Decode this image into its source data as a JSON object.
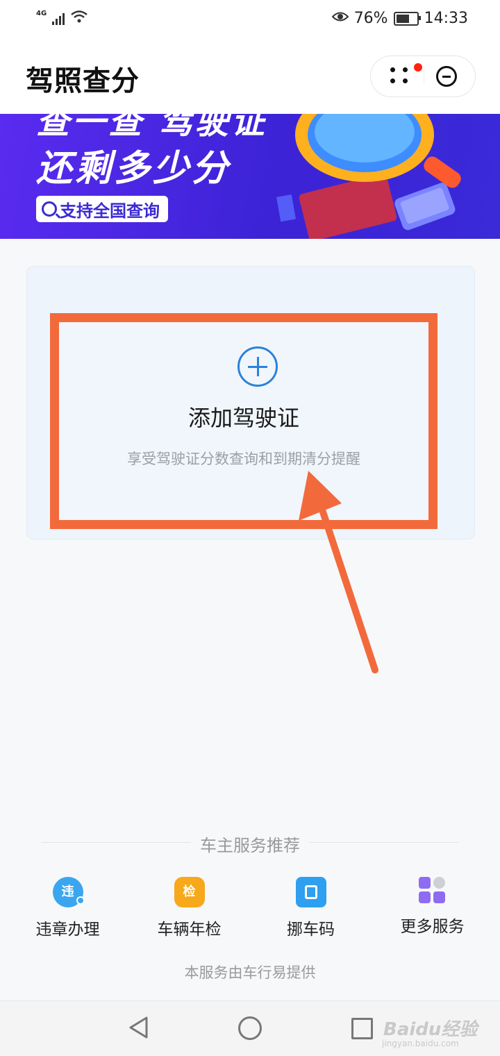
{
  "status_bar": {
    "network": "4G",
    "battery": "76%",
    "battery_level": 0.76,
    "time": "14:33"
  },
  "header": {
    "title": "驾照查分"
  },
  "banner": {
    "line1": "查一查 驾驶证",
    "line2": "还剩多少分",
    "pill": "支持全国查询"
  },
  "add_card": {
    "title": "添加驾驶证",
    "subtitle": "享受驾驶证分数查询和到期清分提醒"
  },
  "recommend": {
    "title": "车主服务推荐",
    "items": [
      {
        "label": "违章办理",
        "icon_text": "违"
      },
      {
        "label": "车辆年检",
        "icon_text": "检"
      },
      {
        "label": "挪车码"
      },
      {
        "label": "更多服务"
      }
    ]
  },
  "footer_note": "本服务由车行易提供",
  "watermark": {
    "text": "Baidu经验",
    "url": "jingyan.baidu.com"
  },
  "colors": {
    "highlight": "#f26a3c",
    "plus": "#2a83d8",
    "banner": "#4a28e4"
  }
}
